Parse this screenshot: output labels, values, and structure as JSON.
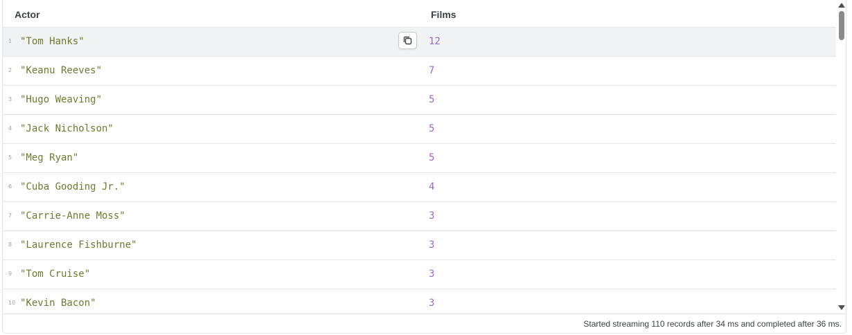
{
  "table": {
    "columns": {
      "actor": "Actor",
      "films": "Films"
    },
    "rows": [
      {
        "num": "1",
        "actor": "\"Tom Hanks\"",
        "films": "12"
      },
      {
        "num": "2",
        "actor": "\"Keanu Reeves\"",
        "films": "7"
      },
      {
        "num": "3",
        "actor": "\"Hugo Weaving\"",
        "films": "5"
      },
      {
        "num": "4",
        "actor": "\"Jack Nicholson\"",
        "films": "5"
      },
      {
        "num": "5",
        "actor": "\"Meg Ryan\"",
        "films": "5"
      },
      {
        "num": "6",
        "actor": "\"Cuba Gooding Jr.\"",
        "films": "4"
      },
      {
        "num": "7",
        "actor": "\"Carrie-Anne Moss\"",
        "films": "3"
      },
      {
        "num": "8",
        "actor": "\"Laurence Fishburne\"",
        "films": "3"
      },
      {
        "num": "9",
        "actor": "\"Tom Cruise\"",
        "films": "3"
      },
      {
        "num": "10",
        "actor": "\"Kevin Bacon\"",
        "films": "3"
      }
    ],
    "hovered_row": 0
  },
  "icons": {
    "copy": "copy-icon"
  },
  "footer": {
    "status": "Started streaming 110 records after 34 ms and completed after 36 ms."
  },
  "colors": {
    "string_value": "#6e7a2f",
    "number_value": "#9a6ac9",
    "border": "#e3e5e8",
    "hover_row": "#f1f2f4"
  }
}
